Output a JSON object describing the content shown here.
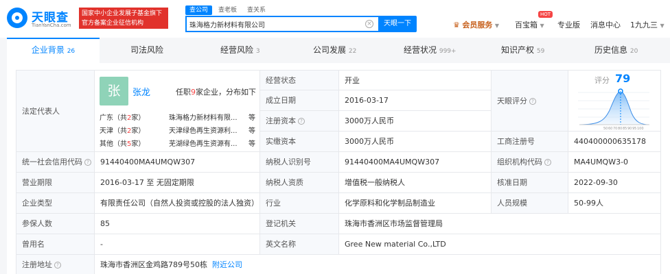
{
  "header": {
    "logo_name": "天眼查",
    "logo_url": "TianYanCha.com",
    "banner_line1": "国家中小企业发展子基金旗下",
    "banner_line2": "官方备案企业征信机构",
    "search_tabs": [
      "查公司",
      "查老板",
      "查关系"
    ],
    "search_value": "珠海格力新材料有限公司",
    "search_button": "天眼一下",
    "nav": {
      "vip": "会员服务",
      "toolbox": "百宝箱",
      "hot_badge": "HOT",
      "pro": "专业版",
      "messages": "消息中心",
      "user": "1九九三"
    }
  },
  "tabs": [
    {
      "label": "企业背景",
      "count": "26"
    },
    {
      "label": "司法风险",
      "count": ""
    },
    {
      "label": "经营风险",
      "count": "3"
    },
    {
      "label": "公司发展",
      "count": "22"
    },
    {
      "label": "经营状况",
      "count": "999+"
    },
    {
      "label": "知识产权",
      "count": "59"
    },
    {
      "label": "历史信息",
      "count": "20"
    }
  ],
  "legal_rep": {
    "label": "法定代表人",
    "avatar_char": "张",
    "name": "张龙",
    "summary_pre": "任职",
    "summary_count": "9",
    "summary_post": "家企业，分布如下",
    "regions": [
      {
        "region": "广东（共",
        "count": "2",
        "suffix": "家）",
        "company": "珠海格力新材料有限...",
        "more": "等"
      },
      {
        "region": "天津（共",
        "count": "2",
        "suffix": "家）",
        "company": "天津绿色再生资源利...",
        "more": "等"
      },
      {
        "region": "其他（共",
        "count": "5",
        "suffix": "家）",
        "company": "芜湖绿色再生资源有...",
        "more": "等"
      }
    ]
  },
  "info": {
    "status_label": "经营状态",
    "status": "开业",
    "founded_label": "成立日期",
    "founded": "2016-03-17",
    "reg_capital_label": "注册资本",
    "reg_capital": "3000万人民币",
    "paid_capital_label": "实缴资本",
    "paid_capital": "3000万人民币",
    "rating_label": "天眼评分",
    "biz_reg_no_label": "工商注册号",
    "biz_reg_no": "440400000635178",
    "credit_code_label": "统一社会信用代码",
    "credit_code": "91440400MA4UMQW307",
    "taxpayer_id_label": "纳税人识别号",
    "taxpayer_id": "91440400MA4UMQW307",
    "org_code_label": "组织机构代码",
    "org_code": "MA4UMQW3-0",
    "term_label": "营业期限",
    "term": "2016-03-17 至 无固定期限",
    "taxpayer_qual_label": "纳税人资质",
    "taxpayer_qual": "增值税一般纳税人",
    "approve_date_label": "核准日期",
    "approve_date": "2022-09-30",
    "company_type_label": "企业类型",
    "company_type": "有限责任公司（自然人投资或控股的法人独资）",
    "industry_label": "行业",
    "industry": "化学原料和化学制品制造业",
    "staff_label": "人员规模",
    "staff": "50-99人",
    "insured_label": "参保人数",
    "insured": "85",
    "authority_label": "登记机关",
    "authority": "珠海市香洲区市场监督管理局",
    "former_name_label": "曾用名",
    "former_name": "-",
    "english_name_label": "英文名称",
    "english_name": "Gree New material Co.,LTD",
    "address_label": "注册地址",
    "address": "珠海市香洲区金鸡路789号50栋",
    "nearby": "附近公司"
  },
  "score": {
    "label": "评分",
    "value": "79",
    "ticks": [
      "50",
      "60",
      "70",
      "80",
      "85",
      "90",
      "95",
      "100"
    ]
  },
  "colors": {
    "brand": "#0084ff",
    "banner": "#e1322c",
    "highlight": "#f54545",
    "vip": "#c7601c"
  }
}
